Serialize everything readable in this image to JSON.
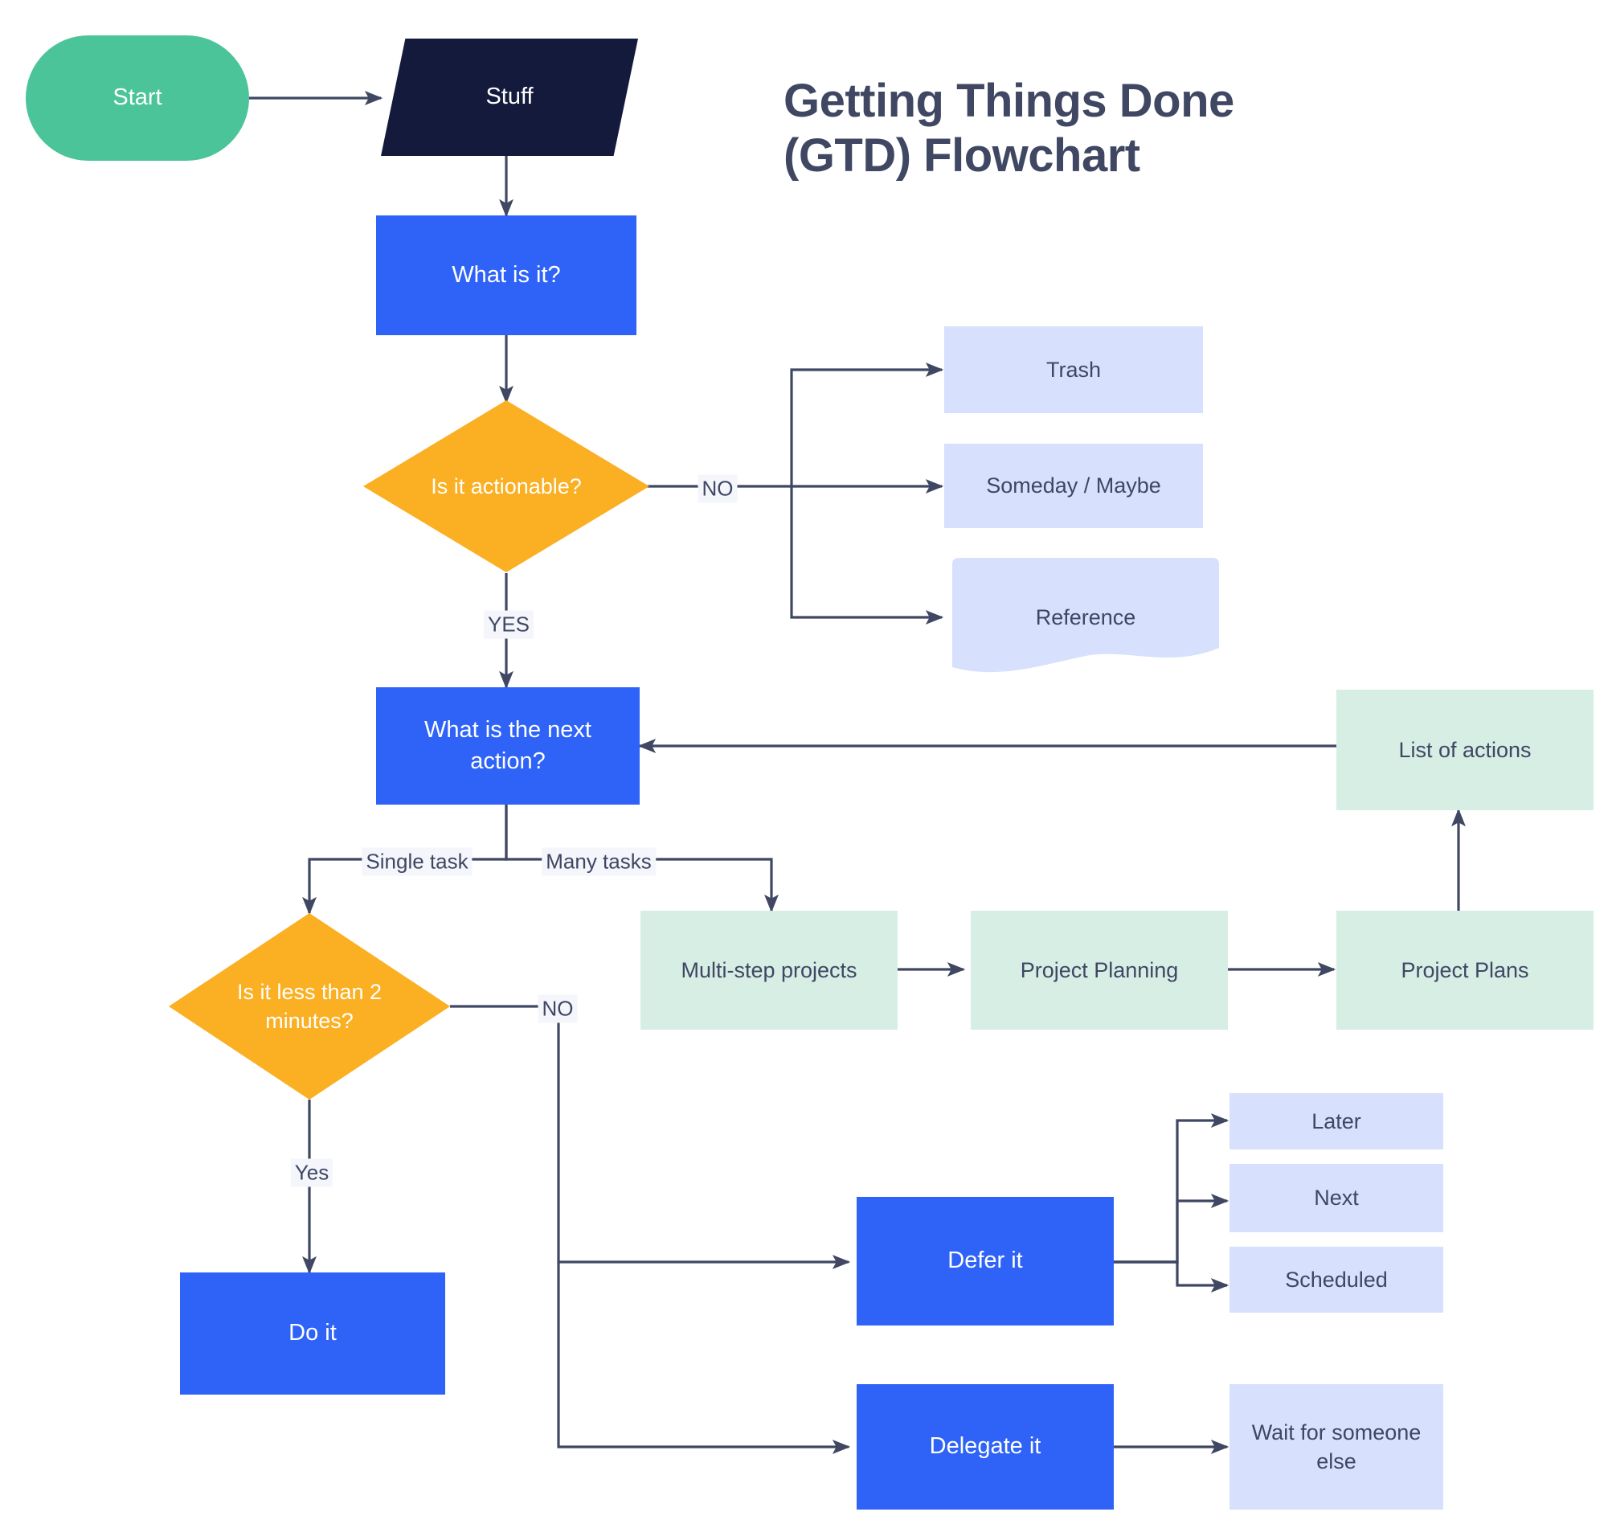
{
  "title": "Getting Things Done\n(GTD) Flowchart",
  "colors": {
    "start_green": "#4CC49A",
    "input_navy": "#131A3C",
    "process_blue": "#2F63F7",
    "decision_orange": "#FBAF22",
    "data_lavender": "#D7E0FD",
    "data_green": "#D7EEE4",
    "edge_slate": "#3F4763",
    "text_dark": "#3F4763",
    "background": "#FFFFFF"
  },
  "nodes": {
    "start": "Start",
    "stuff": "Stuff",
    "what_is_it": "What is it?",
    "is_actionable": "Is it actionable?",
    "trash": "Trash",
    "someday_maybe": "Someday / Maybe",
    "reference": "Reference",
    "next_action": "What is the next\naction?",
    "list_of_actions": "List of actions",
    "is_less_than_2_min": "Is it less than 2\nminutes?",
    "multi_step_projects": "Multi-step projects",
    "project_planning": "Project Planning",
    "project_plans": "Project Plans",
    "do_it": "Do it",
    "defer_it": "Defer it",
    "delegate_it": "Delegate it",
    "later": "Later",
    "next": "Next",
    "scheduled": "Scheduled",
    "wait_for_someone_else": "Wait for someone\nelse"
  },
  "edge_labels": {
    "actionable_no": "NO",
    "actionable_yes": "YES",
    "single_task": "Single task",
    "many_tasks": "Many tasks",
    "two_min_no": "NO",
    "two_min_yes": "Yes"
  }
}
